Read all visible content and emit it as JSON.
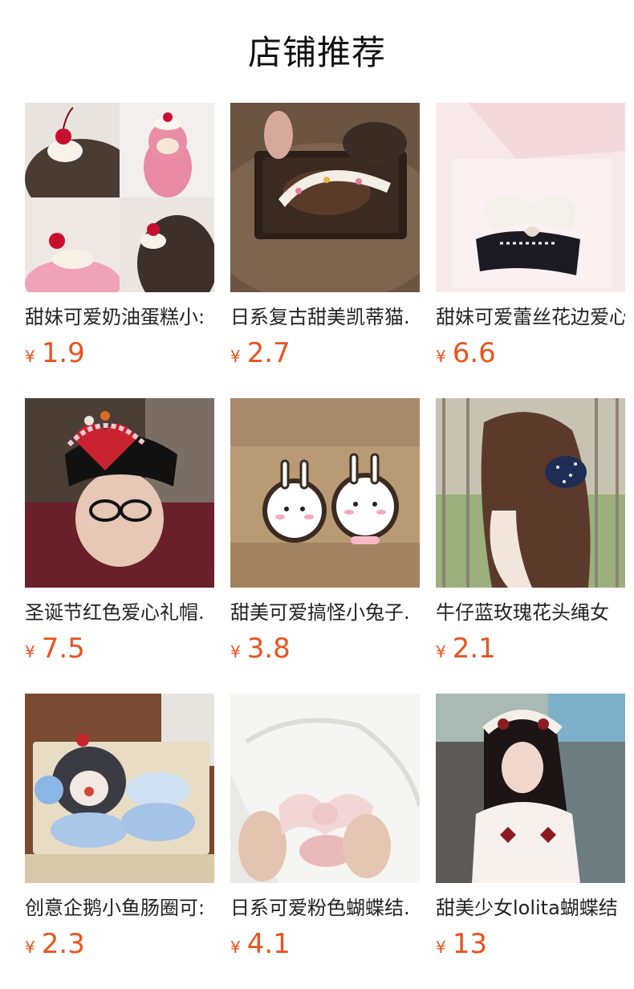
{
  "section": {
    "title": "店铺推荐"
  },
  "currency_symbol": "¥",
  "colors": {
    "price": "#e8541e",
    "title": "#111111",
    "name": "#222222"
  },
  "products": [
    {
      "name": "甜妹可爱奶油蛋糕小:",
      "price": "1.9",
      "image": "cherry-cake-hairclip-photo"
    },
    {
      "name": "日系复古甜美凯蒂猫.",
      "price": "2.7",
      "image": "kitty-headband-photo"
    },
    {
      "name": "甜妹可爱蕾丝花边爱心",
      "price": "6.6",
      "image": "lace-bow-hairclip-box-photo"
    },
    {
      "name": "圣诞节红色爱心礼帽.",
      "price": "7.5",
      "image": "red-heart-hat-photo"
    },
    {
      "name": "甜美可爱搞怪小兔子.",
      "price": "3.8",
      "image": "bunny-hairclip-photo"
    },
    {
      "name": "牛仔蓝玫瑰花头绳女",
      "price": "2.1",
      "image": "denim-scrunchie-photo"
    },
    {
      "name": "创意企鹅小鱼肠圈可:",
      "price": "2.3",
      "image": "penguin-scrunchie-photo"
    },
    {
      "name": "日系可爱粉色蝴蝶结.",
      "price": "4.1",
      "image": "pink-bow-scrunchie-photo"
    },
    {
      "name": "甜美少女lolita蝴蝶结",
      "price": "13",
      "image": "lolita-headdress-photo"
    }
  ]
}
